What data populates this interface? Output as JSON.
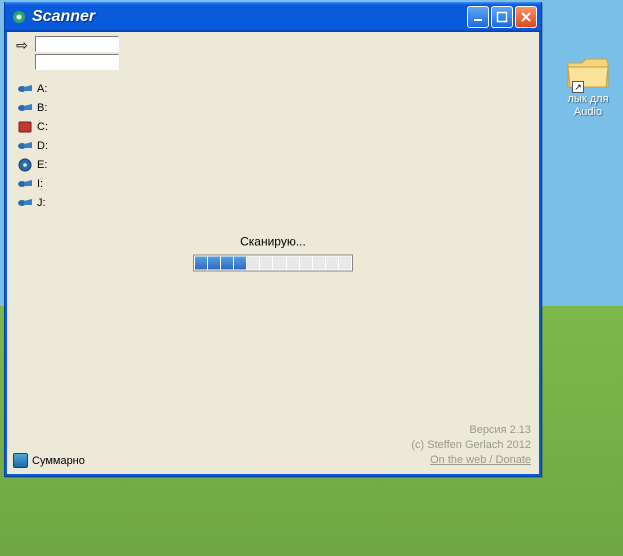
{
  "desktop": {
    "shortcut": {
      "label_line1": "лык для",
      "label_line2": "Audio"
    }
  },
  "window": {
    "title": "Scanner",
    "path_input_1": "",
    "path_input_2": ""
  },
  "drives": [
    {
      "label": "A:",
      "kind": "blue"
    },
    {
      "label": "B:",
      "kind": "blue"
    },
    {
      "label": "C:",
      "kind": "red"
    },
    {
      "label": "D:",
      "kind": "blue"
    },
    {
      "label": "E:",
      "kind": "disc"
    },
    {
      "label": "I:",
      "kind": "blue"
    },
    {
      "label": "J:",
      "kind": "blue"
    }
  ],
  "status_text": "Сканирую...",
  "progress": {
    "filled": 4,
    "total": 12
  },
  "footer": {
    "summary_label": "Суммарно",
    "version": "Версия 2.13",
    "copyright": "(c) Steffen Gerlach 2012",
    "link": "On the web / Donate"
  }
}
